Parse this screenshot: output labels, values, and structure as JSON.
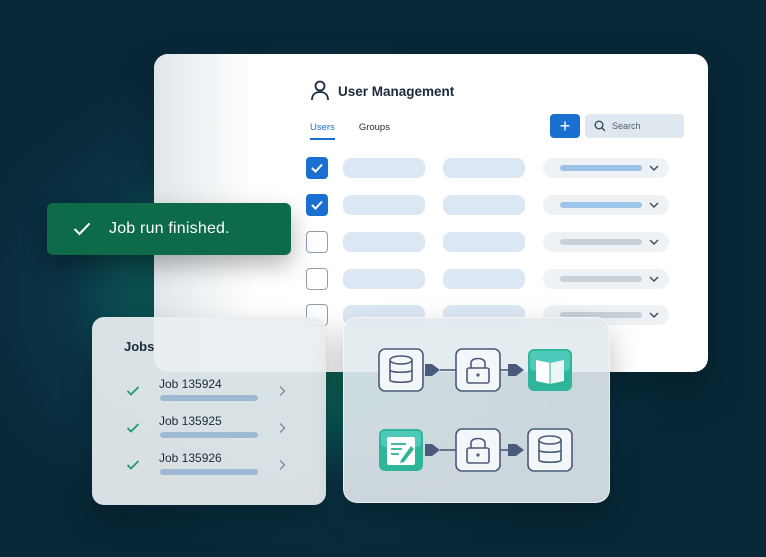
{
  "user_management": {
    "title": "User Management",
    "tabs": [
      {
        "label": "Users",
        "active": true
      },
      {
        "label": "Groups",
        "active": false
      }
    ],
    "add_button_label": "+",
    "search": {
      "placeholder": "Search"
    },
    "rows": [
      {
        "checked": true,
        "dropdown_color": "#9cc3e8"
      },
      {
        "checked": true,
        "dropdown_color": "#9cc3e8"
      },
      {
        "checked": false,
        "dropdown_color": "#c8d0d8"
      },
      {
        "checked": false,
        "dropdown_color": "#c8d0d8"
      },
      {
        "checked": false,
        "dropdown_color": "#c8d0d8"
      }
    ]
  },
  "toast": {
    "message": "Job run finished."
  },
  "jobs": {
    "title": "Jobs",
    "items": [
      {
        "name": "Job 135924",
        "status": "success"
      },
      {
        "name": "Job 135925",
        "status": "success"
      },
      {
        "name": "Job 135926",
        "status": "success"
      }
    ]
  },
  "pipeline": {
    "flows": [
      [
        "database-icon",
        "lock-icon",
        "book-icon"
      ],
      [
        "document-icon",
        "lock-icon",
        "database-icon"
      ]
    ]
  },
  "colors": {
    "accent": "#1b6fd1",
    "success": "#0d6b4a",
    "check": "#1d9a6c"
  }
}
